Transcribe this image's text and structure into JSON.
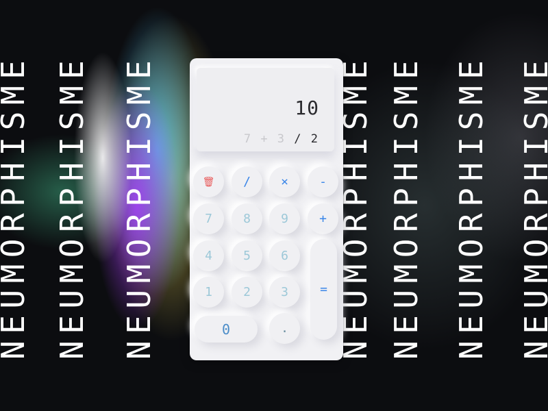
{
  "background": {
    "repeated_word": "NEUMORPHISME"
  },
  "calculator": {
    "display": {
      "result": "10",
      "expression_dim": "7 + 3",
      "expression_active": "/ 2"
    },
    "buttons": {
      "delete": {
        "icon": "trash-icon",
        "label": "🗑"
      },
      "divide": "/",
      "multiply": "×",
      "minus": "-",
      "seven": "7",
      "eight": "8",
      "nine": "9",
      "plus": "+",
      "four": "4",
      "five": "5",
      "six": "6",
      "equals": "=",
      "one": "1",
      "two": "2",
      "three": "3",
      "zero": "0",
      "decimal": "."
    },
    "colors": {
      "operator": "#3a86e8",
      "delete": "#e85858",
      "digit": "#9cc8d8",
      "body": "#f1f1f4"
    }
  }
}
